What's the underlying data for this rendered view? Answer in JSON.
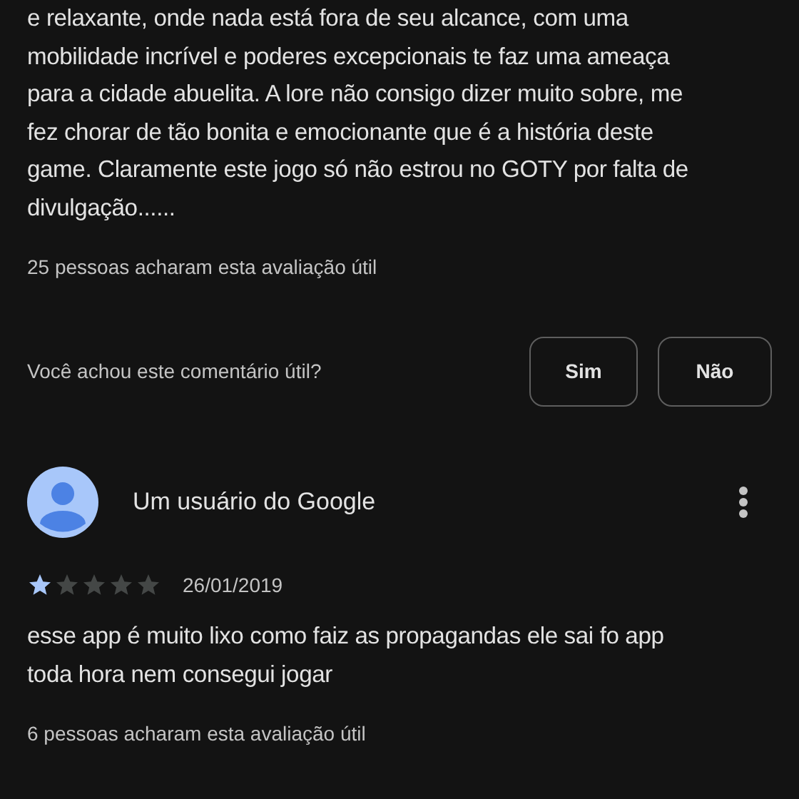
{
  "reviews": [
    {
      "text_lines": [
        "e relaxante, onde nada está fora de seu alcance, com uma",
        "mobilidade incrível e poderes excepcionais te faz uma ameaça",
        "para a cidade abuelita. A lore não consigo dizer muito sobre, me",
        "fez chorar de tão bonita e emocionante que é a história deste",
        "game. Claramente este jogo só não estrou no GOTY por falta de",
        "divulgação......"
      ],
      "helpful_count": "25 pessoas acharam esta avaliação útil",
      "feedback": {
        "question": "Você achou este comentário útil?",
        "buttons": [
          "Sim",
          "Não"
        ]
      }
    },
    {
      "author": "Um usuário do Google",
      "stars": 1,
      "date": "26/01/2019",
      "text_lines": [
        "esse app é muito lixo como faiz as propagandas ele sai fo app",
        "toda hora nem consegui jogar"
      ],
      "helpful_count": "6 pessoas acharam esta avaliação útil"
    }
  ]
}
